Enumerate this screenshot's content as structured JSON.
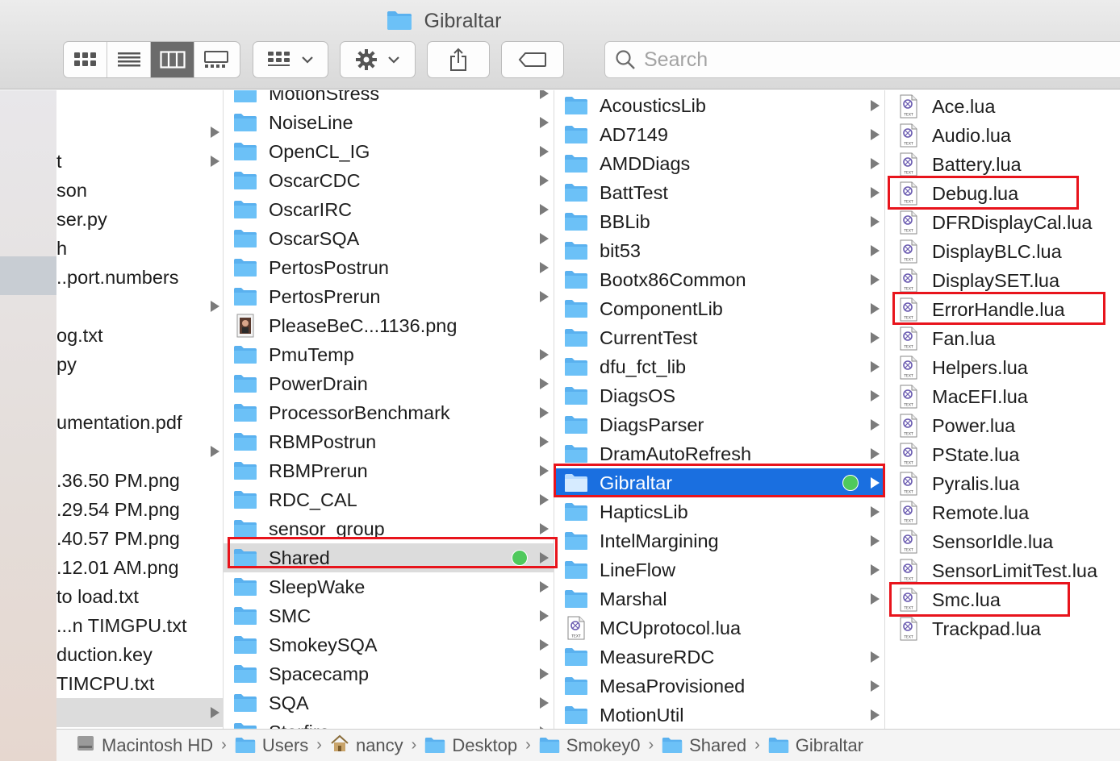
{
  "window": {
    "title": "Gibraltar",
    "accent": "#1a6fe0",
    "highlight": "#e8141c",
    "tag_green": "#4fc95c"
  },
  "toolbar": {
    "view_modes": [
      "icon-view-icon",
      "list-view-icon",
      "column-view-icon",
      "gallery-view-icon"
    ],
    "active_view": "column",
    "group_button_icon": "group-grid-icon",
    "action_button_icon": "gear-icon",
    "share_button_icon": "share-icon",
    "tags_button_icon": "tag-icon"
  },
  "search": {
    "placeholder": "Search",
    "value": ""
  },
  "column1": {
    "items": [
      {
        "label": "",
        "arrow": true
      },
      {
        "label": "t",
        "arrow": true
      },
      {
        "label": "son",
        "arrow": false
      },
      {
        "label": "ser.py",
        "arrow": false
      },
      {
        "label": "h",
        "arrow": false
      },
      {
        "label": "..port.numbers",
        "arrow": false
      },
      {
        "label": "",
        "arrow": true
      },
      {
        "label": "og.txt",
        "arrow": false
      },
      {
        "label": "py",
        "arrow": false
      },
      {
        "label": "",
        "arrow": false
      },
      {
        "label": "umentation.pdf",
        "arrow": false
      },
      {
        "label": "",
        "arrow": true
      },
      {
        "label": ".36.50 PM.png",
        "arrow": false
      },
      {
        "label": ".29.54 PM.png",
        "arrow": false
      },
      {
        "label": ".40.57 PM.png",
        "arrow": false
      },
      {
        "label": ".12.01 AM.png",
        "arrow": false
      },
      {
        "label": "to load.txt",
        "arrow": false
      },
      {
        "label": "...n TIMGPU.txt",
        "arrow": false
      },
      {
        "label": "duction.key",
        "arrow": false
      },
      {
        "label": "TIMCPU.txt",
        "arrow": false
      },
      {
        "label": "",
        "arrow": true,
        "selected": true
      }
    ]
  },
  "column2": {
    "items": [
      {
        "label": "MotionStress",
        "type": "folder"
      },
      {
        "label": "NoiseLine",
        "type": "folder"
      },
      {
        "label": "OpenCL_IG",
        "type": "folder"
      },
      {
        "label": "OscarCDC",
        "type": "folder"
      },
      {
        "label": "OscarIRC",
        "type": "folder"
      },
      {
        "label": "OscarSQA",
        "type": "folder"
      },
      {
        "label": "PertosPostrun",
        "type": "folder"
      },
      {
        "label": "PertosPrerun",
        "type": "folder"
      },
      {
        "label": "PleaseBeC...1136.png",
        "type": "image"
      },
      {
        "label": "PmuTemp",
        "type": "folder"
      },
      {
        "label": "PowerDrain",
        "type": "folder"
      },
      {
        "label": "ProcessorBenchmark",
        "type": "folder"
      },
      {
        "label": "RBMPostrun",
        "type": "folder"
      },
      {
        "label": "RBMPrerun",
        "type": "folder"
      },
      {
        "label": "RDC_CAL",
        "type": "folder"
      },
      {
        "label": "sensor_group",
        "type": "folder"
      },
      {
        "label": "Shared",
        "type": "folder",
        "selected": true,
        "tag": "green"
      },
      {
        "label": "SleepWake",
        "type": "folder"
      },
      {
        "label": "SMC",
        "type": "folder"
      },
      {
        "label": "SmokeySQA",
        "type": "folder"
      },
      {
        "label": "Spacecamp",
        "type": "folder"
      },
      {
        "label": "SQA",
        "type": "folder"
      },
      {
        "label": "Starfire",
        "type": "folder"
      }
    ]
  },
  "column3": {
    "items": [
      {
        "label": "AcousticsLib",
        "type": "folder"
      },
      {
        "label": "AD7149",
        "type": "folder"
      },
      {
        "label": "AMDDiags",
        "type": "folder"
      },
      {
        "label": "BattTest",
        "type": "folder"
      },
      {
        "label": "BBLib",
        "type": "folder"
      },
      {
        "label": "bit53",
        "type": "folder"
      },
      {
        "label": "Bootx86Common",
        "type": "folder"
      },
      {
        "label": "ComponentLib",
        "type": "folder"
      },
      {
        "label": "CurrentTest",
        "type": "folder"
      },
      {
        "label": "dfu_fct_lib",
        "type": "folder"
      },
      {
        "label": "DiagsOS",
        "type": "folder"
      },
      {
        "label": "DiagsParser",
        "type": "folder"
      },
      {
        "label": "DramAutoRefresh",
        "type": "folder"
      },
      {
        "label": "Gibraltar",
        "type": "folder",
        "selected": true,
        "tag": "green"
      },
      {
        "label": "HapticsLib",
        "type": "folder"
      },
      {
        "label": "IntelMargining",
        "type": "folder"
      },
      {
        "label": "LineFlow",
        "type": "folder"
      },
      {
        "label": "Marshal",
        "type": "folder"
      },
      {
        "label": "MCUprotocol.lua",
        "type": "text"
      },
      {
        "label": "MeasureRDC",
        "type": "folder"
      },
      {
        "label": "MesaProvisioned",
        "type": "folder"
      },
      {
        "label": "MotionUtil",
        "type": "folder"
      }
    ]
  },
  "column4": {
    "items": [
      {
        "label": "Ace.lua",
        "type": "text"
      },
      {
        "label": "Audio.lua",
        "type": "text"
      },
      {
        "label": "Battery.lua",
        "type": "text"
      },
      {
        "label": "Debug.lua",
        "type": "text",
        "highlighted": true
      },
      {
        "label": "DFRDisplayCal.lua",
        "type": "text"
      },
      {
        "label": "DisplayBLC.lua",
        "type": "text"
      },
      {
        "label": "DisplaySET.lua",
        "type": "text"
      },
      {
        "label": "ErrorHandle.lua",
        "type": "text",
        "highlighted": true
      },
      {
        "label": "Fan.lua",
        "type": "text"
      },
      {
        "label": "Helpers.lua",
        "type": "text"
      },
      {
        "label": "MacEFI.lua",
        "type": "text"
      },
      {
        "label": "Power.lua",
        "type": "text"
      },
      {
        "label": "PState.lua",
        "type": "text"
      },
      {
        "label": "Pyralis.lua",
        "type": "text"
      },
      {
        "label": "Remote.lua",
        "type": "text"
      },
      {
        "label": "SensorIdle.lua",
        "type": "text"
      },
      {
        "label": "SensorLimitTest.lua",
        "type": "text"
      },
      {
        "label": "Smc.lua",
        "type": "text",
        "highlighted": true
      },
      {
        "label": "Trackpad.lua",
        "type": "text"
      }
    ]
  },
  "text_icon_caption": "TEXT",
  "pathbar": {
    "items": [
      {
        "label": "Macintosh HD",
        "icon": "hard-drive-icon"
      },
      {
        "label": "Users",
        "icon": "users-folder-icon"
      },
      {
        "label": "nancy",
        "icon": "home-icon"
      },
      {
        "label": "Desktop",
        "icon": "desktop-folder-icon"
      },
      {
        "label": "Smokey0",
        "icon": "folder-icon"
      },
      {
        "label": "Shared",
        "icon": "folder-icon"
      },
      {
        "label": "Gibraltar",
        "icon": "folder-icon"
      }
    ],
    "separator": "›"
  }
}
